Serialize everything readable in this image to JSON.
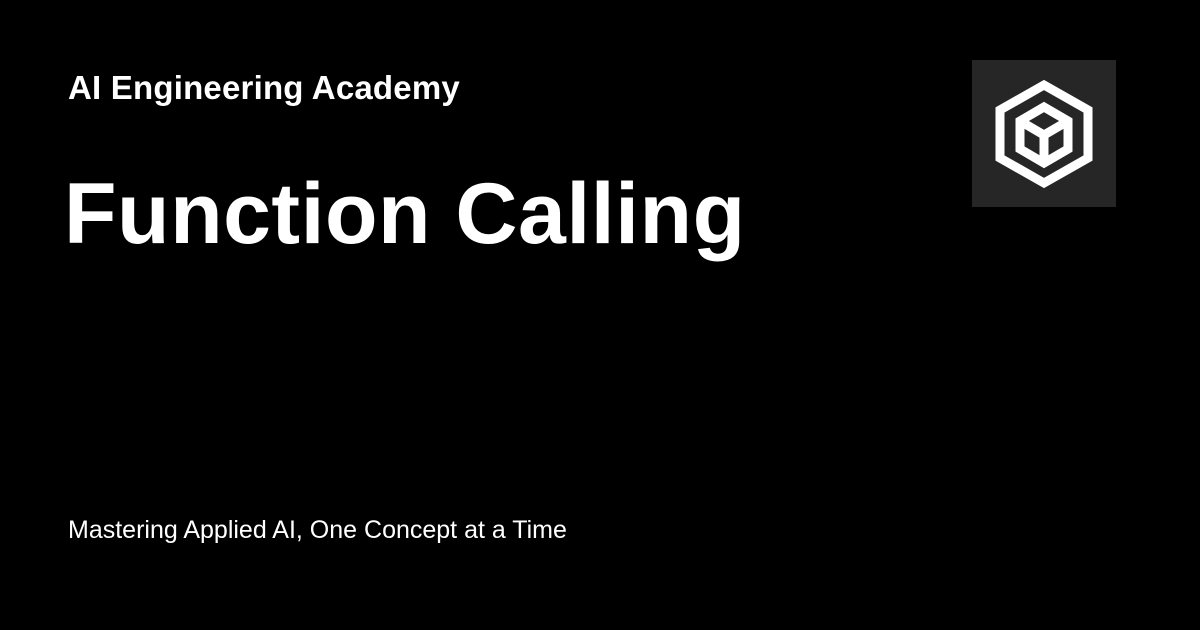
{
  "site": {
    "name": "AI Engineering Academy"
  },
  "page": {
    "title": "Function Calling",
    "tagline": "Mastering Applied AI, One Concept at a Time"
  },
  "logo": {
    "icon": "hexagon-cube-logo-icon",
    "background": "#262626",
    "stroke": "#ffffff"
  },
  "colors": {
    "background": "#000000",
    "text": "#ffffff"
  }
}
